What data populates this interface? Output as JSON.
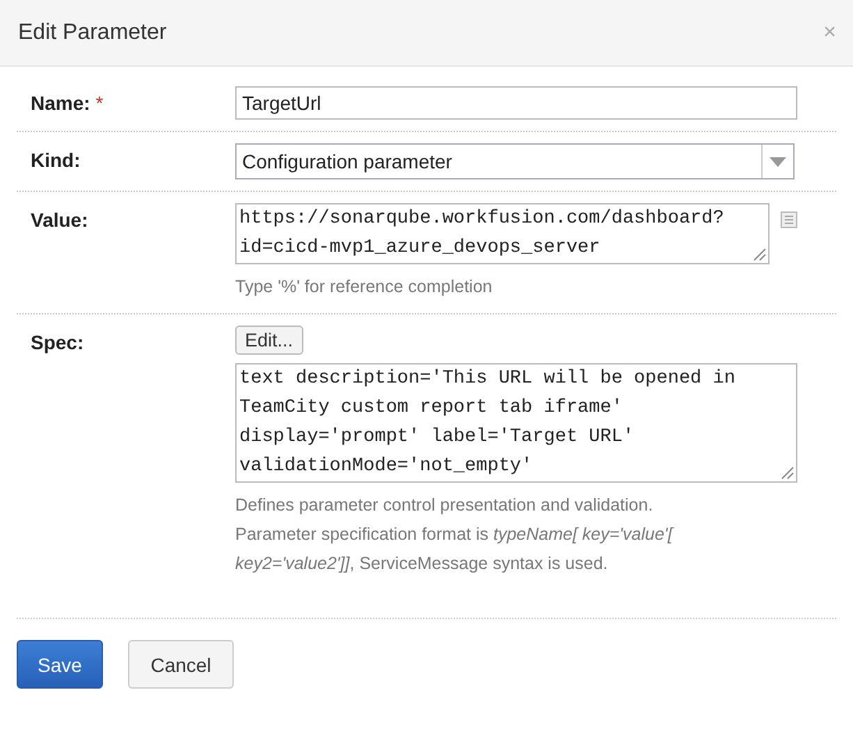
{
  "dialog": {
    "title": "Edit Parameter",
    "close": "×"
  },
  "fields": [
    {
      "kind": "text",
      "label": "Name:",
      "required": true,
      "required_mark": "*",
      "value": "TargetUrl"
    },
    {
      "kind": "select",
      "label": "Kind:",
      "value": "Configuration parameter"
    },
    {
      "kind": "textarea",
      "label": "Value:",
      "value": "https://sonarqube.workfusion.com/dashboard?\nid=cicd-mvp1_azure_devops_server",
      "note": "Type '%' for reference completion"
    },
    {
      "kind": "spec",
      "label": "Spec:",
      "button": "Edit...",
      "value": "text description='This URL will be opened in\nTeamCity custom report tab iframe'\ndisplay='prompt' label='Target URL'\nvalidationMode='not_empty'",
      "note": "Defines parameter control presentation and validation. Parameter specification format is *typeName[ key='value'[ key2='value2']]*, ServiceMessage syntax is used."
    }
  ],
  "buttons": [
    {
      "label": "Save",
      "primary": true
    },
    {
      "label": "Cancel",
      "primary": false
    }
  ]
}
